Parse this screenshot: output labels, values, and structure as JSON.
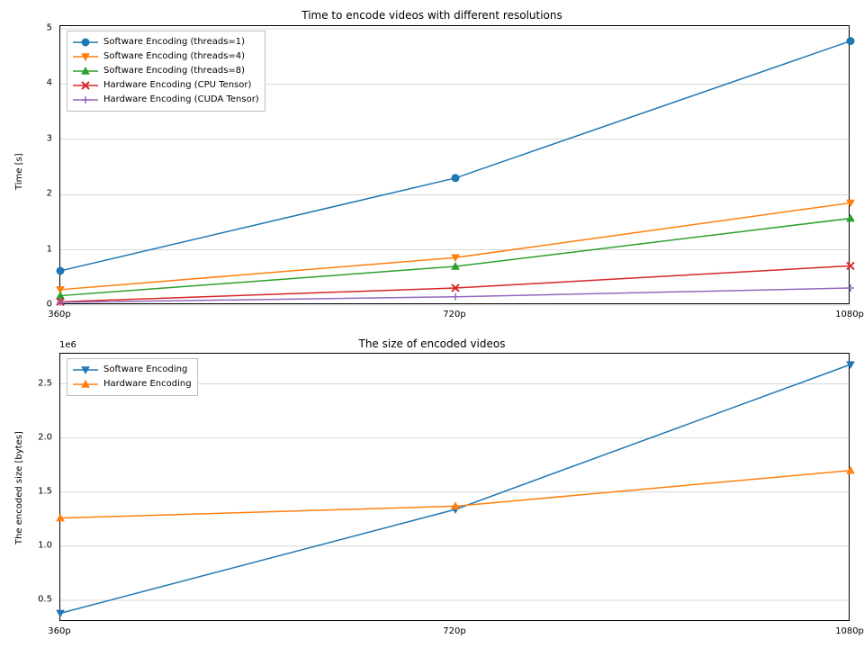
{
  "chart_data": [
    {
      "type": "line",
      "title": "Time to encode videos with different resolutions",
      "xlabel": "",
      "ylabel": "Time [s]",
      "categories": [
        "360p",
        "720p",
        "1080p"
      ],
      "ylim": [
        0,
        5.05
      ],
      "yticks": [
        0,
        1,
        2,
        3,
        4,
        5
      ],
      "series": [
        {
          "name": "Software Encoding (threads=1)",
          "values": [
            0.62,
            2.3,
            4.78
          ],
          "color": "#1f77b4",
          "marker": "circle"
        },
        {
          "name": "Software Encoding (threads=4)",
          "values": [
            0.28,
            0.86,
            1.85
          ],
          "color": "#ff7f0e",
          "marker": "triangle-down"
        },
        {
          "name": "Software Encoding (threads=8)",
          "values": [
            0.17,
            0.7,
            1.57
          ],
          "color": "#2ca02c",
          "marker": "triangle-up"
        },
        {
          "name": "Hardware Encoding (CPU Tensor)",
          "values": [
            0.06,
            0.31,
            0.71
          ],
          "color": "#d62728",
          "marker": "x"
        },
        {
          "name": "Hardware Encoding (CUDA Tensor)",
          "values": [
            0.05,
            0.15,
            0.31
          ],
          "color": "#9467bd",
          "marker": "plus"
        }
      ]
    },
    {
      "type": "line",
      "title": "The size of encoded videos",
      "xlabel": "",
      "ylabel": "The encoded size [bytes]",
      "y_scale_note": "1e6",
      "categories": [
        "360p",
        "720p",
        "1080p"
      ],
      "ylim": [
        300000,
        2780000
      ],
      "yticks": [
        500000,
        1000000,
        1500000,
        2000000,
        2500000
      ],
      "ytick_labels": [
        "0.5",
        "1.0",
        "1.5",
        "2.0",
        "2.5"
      ],
      "series": [
        {
          "name": "Software Encoding",
          "values": [
            380000,
            1340000,
            2680000
          ],
          "color": "#1f77b4",
          "marker": "triangle-down"
        },
        {
          "name": "Hardware Encoding",
          "values": [
            1260000,
            1370000,
            1700000
          ],
          "color": "#ff7f0e",
          "marker": "triangle-up"
        }
      ]
    }
  ]
}
